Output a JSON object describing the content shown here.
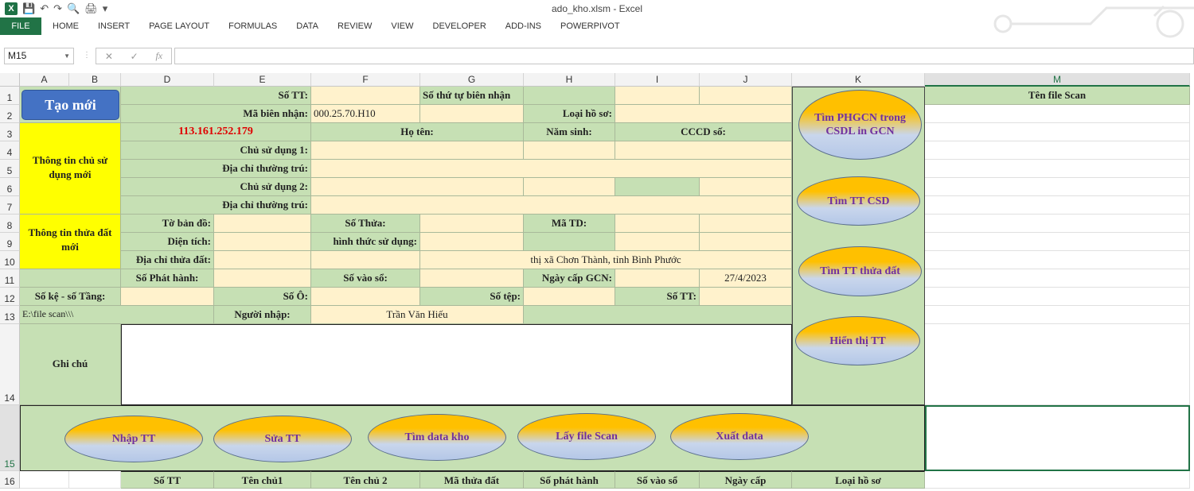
{
  "window": {
    "title": "ado_kho.xlsm - Excel"
  },
  "ribbon": {
    "tabs": [
      "FILE",
      "HOME",
      "INSERT",
      "PAGE LAYOUT",
      "FORMULAS",
      "DATA",
      "REVIEW",
      "VIEW",
      "DEVELOPER",
      "ADD-INS",
      "POWERPIVOT"
    ]
  },
  "formula_bar": {
    "name_box": "M15",
    "formula": "",
    "fx": "fx"
  },
  "columns": [
    "A",
    "B",
    "D",
    "E",
    "F",
    "G",
    "H",
    "I",
    "J",
    "K",
    "M"
  ],
  "rows": [
    "1",
    "2",
    "3",
    "4",
    "5",
    "6",
    "7",
    "8",
    "9",
    "10",
    "11",
    "12",
    "13",
    "14",
    "15",
    "16"
  ],
  "buttons": {
    "tao_moi": "Tạo mới",
    "tim_phgcn": "Tìm PHGCN trong CSDL in GCN",
    "tim_tt_csd": "Tìm TT CSD",
    "tim_tt_thua_dat": "Tìm TT thửa đất",
    "hien_thi_tt": "Hiển thị TT",
    "nhap_tt": "Nhập TT",
    "sua_tt": "Sửa TT",
    "tim_data_kho": "Tìm data kho",
    "lay_file_scan": "Lấy file Scan",
    "xuat_data": "Xuất data"
  },
  "form": {
    "so_tt": "Số TT:",
    "so_thu_tu_bien_nhan": "Số thứ tự biên nhận",
    "ma_bien_nhan": "Mã biên nhận:",
    "ma_bien_nhan_value": "000.25.70.H10",
    "loai_ho_so": "Loại hồ sơ:",
    "ip": "113.161.252.179",
    "ho_ten": "Họ tên:",
    "nam_sinh": "Năm sinh:",
    "cccd_so": "CCCD số:",
    "thong_tin_csd_moi": "Thông tin chủ sử dụng mới",
    "chu_su_dung_1": "Chủ sử dụng 1:",
    "dia_chi_thuong_tru_1": "Địa chỉ thường trú:",
    "chu_su_dung_2": "Chủ sử dụng 2:",
    "dia_chi_thuong_tru_2": "Địa chỉ thường trú:",
    "thong_tin_thua_dat_moi": "Thông tin thửa đất mới",
    "to_ban_do": "Tờ bản đồ:",
    "so_thua": "Số Thửa:",
    "ma_td": "Mã TD:",
    "dien_tich": "Diện tích:",
    "hinh_thuc_su_dung": "hình thức sử dụng:",
    "dia_chi_thua_dat": "Địa chỉ thửa đất:",
    "dia_chi_thua_dat_value": "thị xã Chơn Thành, tỉnh Bình Phước",
    "so_phat_hanh": "Số Phát hành:",
    "so_vao_so": "Số vào sổ:",
    "ngay_cap_gcn": "Ngày cấp GCN:",
    "ngay_cap_gcn_value": "27/4/2023",
    "so_ke_so_tang": "Số kệ - số Tầng:",
    "so_o": "Số Ô:",
    "so_tep": "Số tệp:",
    "so_tt_2": "Số TT:",
    "path": "E:\\file scan\\\\\\",
    "nguoi_nhap": "Người nhập:",
    "nguoi_nhap_value": "Trần Văn Hiếu",
    "ghi_chu": "Ghi chú",
    "ten_file_scan": "Tên file Scan"
  },
  "table_header": [
    "Số TT",
    "Tên chủ1",
    "Tên chủ 2",
    "Mã thửa đất",
    "Số phát hành",
    "Số vào sổ",
    "Ngày cấp",
    "Loại hồ sơ"
  ]
}
